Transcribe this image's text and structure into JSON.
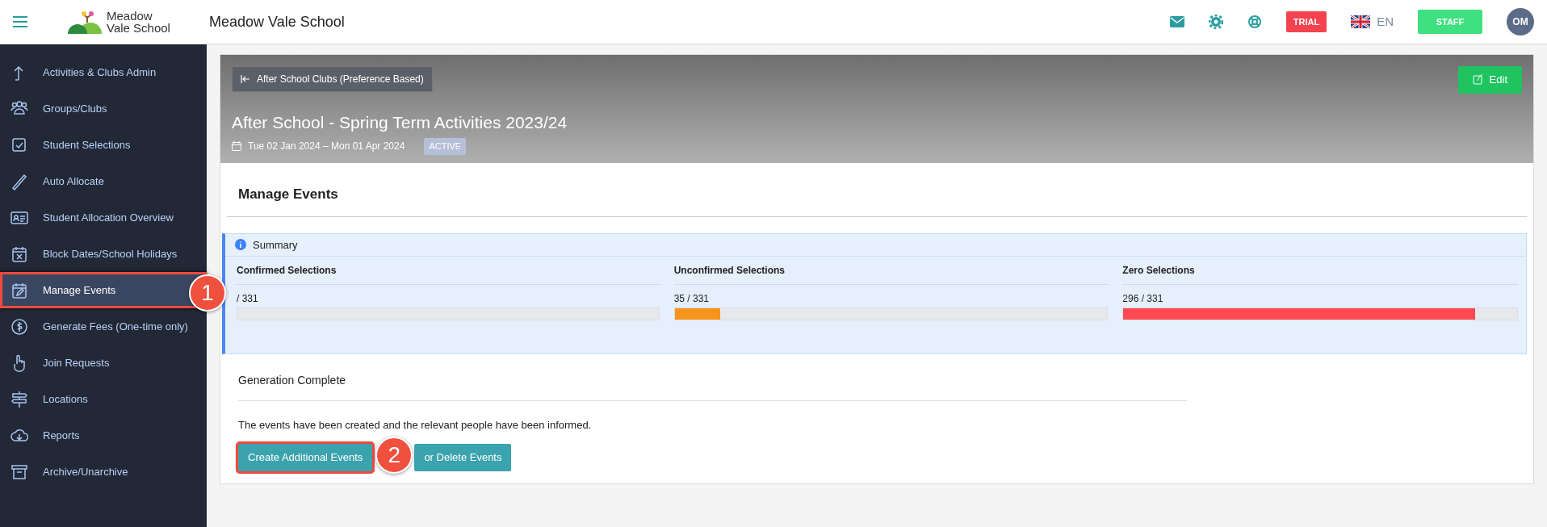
{
  "topbar": {
    "logo_lines": [
      "Meadow",
      "Vale School"
    ],
    "school_name": "Meadow Vale School",
    "trial_badge": "TRIAL",
    "language": "EN",
    "role_button": "STAFF",
    "avatar_initials": "OM"
  },
  "sidebar": {
    "items": [
      {
        "label": "Activities & Clubs Admin",
        "selected": false,
        "highlighted": false
      },
      {
        "label": "Groups/Clubs",
        "selected": false,
        "highlighted": false
      },
      {
        "label": "Student Selections",
        "selected": false,
        "highlighted": false
      },
      {
        "label": "Auto Allocate",
        "selected": false,
        "highlighted": false
      },
      {
        "label": "Student Allocation Overview",
        "selected": false,
        "highlighted": false
      },
      {
        "label": "Block Dates/School Holidays",
        "selected": false,
        "highlighted": false
      },
      {
        "label": "Manage Events",
        "selected": true,
        "highlighted": true
      },
      {
        "label": "Generate Fees (One-time only)",
        "selected": false,
        "highlighted": false
      },
      {
        "label": "Join Requests",
        "selected": false,
        "highlighted": false
      },
      {
        "label": "Locations",
        "selected": false,
        "highlighted": false
      },
      {
        "label": "Reports",
        "selected": false,
        "highlighted": false
      },
      {
        "label": "Archive/Unarchive",
        "selected": false,
        "highlighted": false
      }
    ]
  },
  "header": {
    "back_button": "After School Clubs (Preference Based)",
    "edit_button": "Edit",
    "title": "After School - Spring Term Activities 2023/24",
    "date_range": "Tue 02 Jan 2024 – Mon 01 Apr 2024",
    "status_badge": "ACTIVE"
  },
  "section_title": "Manage Events",
  "summary": {
    "title": "Summary",
    "stats": [
      {
        "label": "Confirmed Selections",
        "reading": "/ 331"
      },
      {
        "label": "Unconfirmed Selections",
        "reading": "35 / 331",
        "level": 0.106,
        "color": "#f7941d"
      },
      {
        "label": "Zero Selections",
        "reading": "296 / 331",
        "level": 0.894,
        "color": "#ff4a55"
      }
    ]
  },
  "generation": {
    "title": "Generation Complete",
    "message": "The events have been created and the relevant people have been informed.",
    "buttons": [
      {
        "label": "Create Additional Events",
        "highlighted": true
      },
      {
        "label": "or Delete Events",
        "highlighted": false
      }
    ]
  },
  "annotations": [
    {
      "label": "1"
    },
    {
      "label": "2"
    }
  ]
}
